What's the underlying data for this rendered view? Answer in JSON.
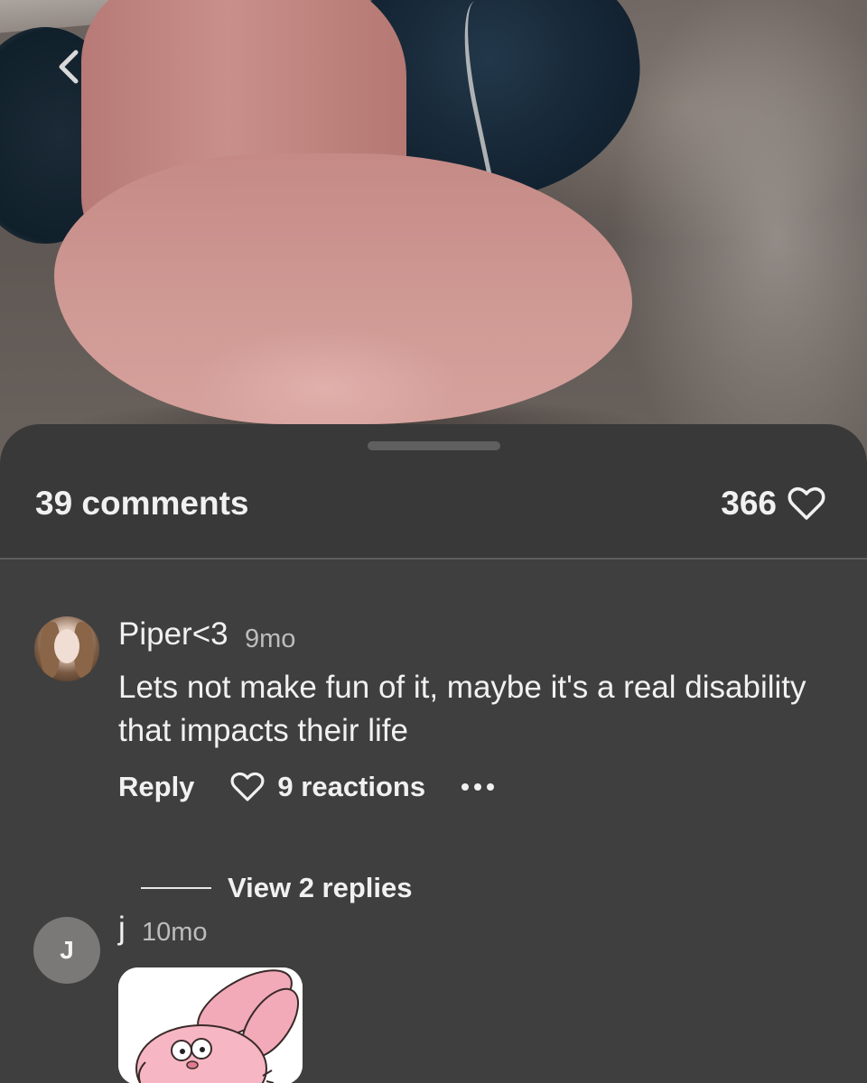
{
  "header": {
    "comments_count_label": "39 comments",
    "likes_count": "366",
    "like_icon": "heart-outline-icon",
    "back_icon": "chevron-left-icon"
  },
  "comments": [
    {
      "username": "Piper<3",
      "time": "9mo",
      "text": "Lets not make fun of it, maybe it's a real disability that impacts their life",
      "reply_label": "Reply",
      "reactions_label": "9 reactions",
      "reaction_icon": "heart-outline-icon",
      "more_icon": "more-dots-icon",
      "view_replies_label": "View 2 replies"
    },
    {
      "username": "j",
      "avatar_initial": "J",
      "time": "10mo",
      "attachment": "sticker-image"
    }
  ],
  "colors": {
    "sheet_background": "#3a3939",
    "text_primary": "#f1f1f1",
    "text_secondary": "#bdbdbd"
  }
}
